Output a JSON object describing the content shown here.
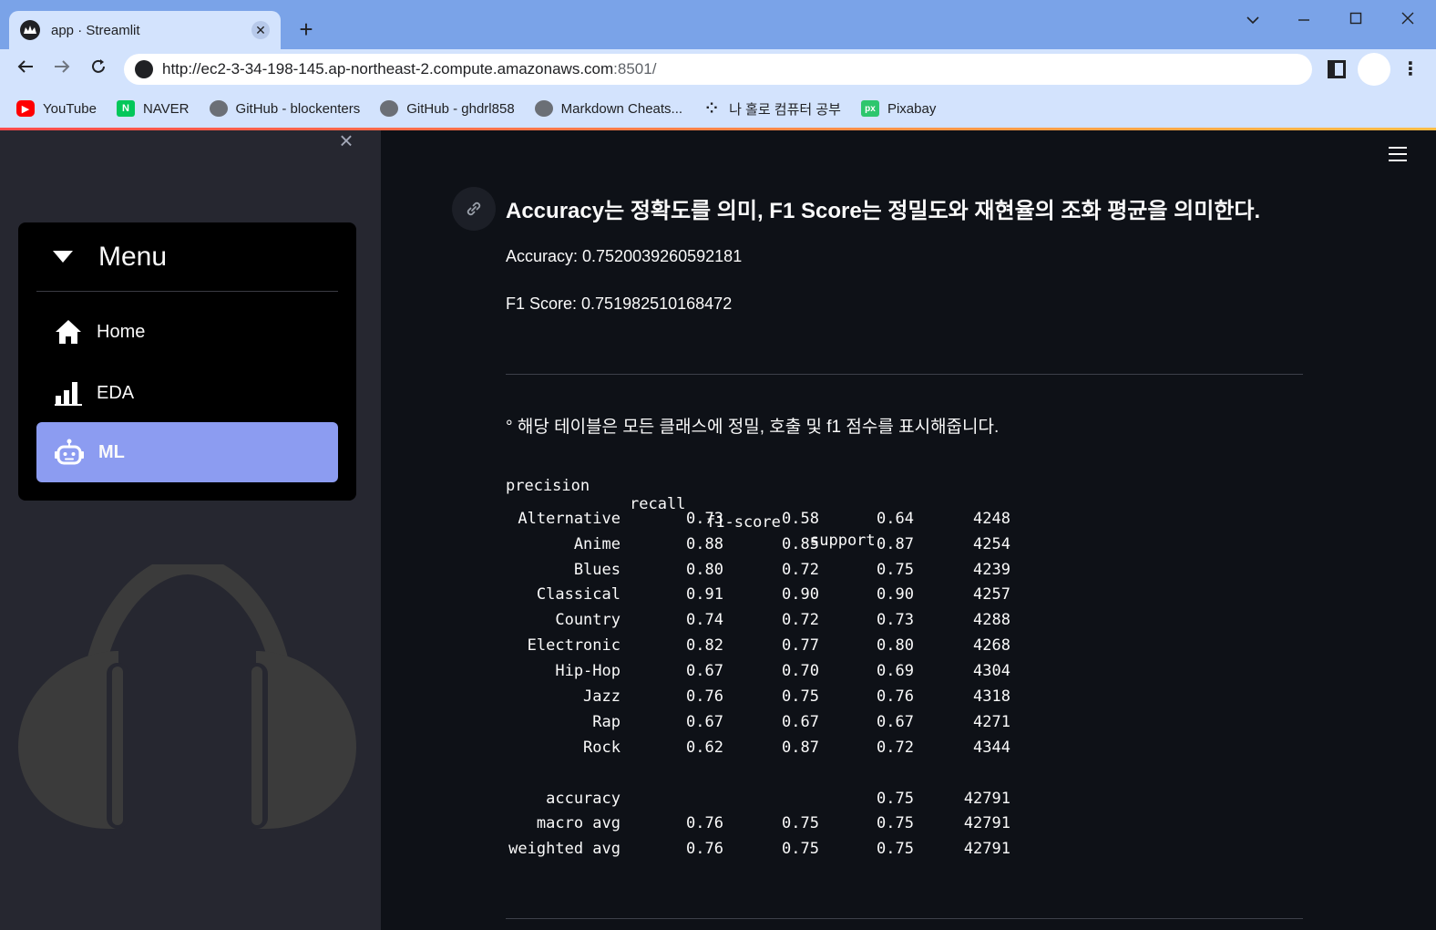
{
  "browser": {
    "tab_title": "app · Streamlit",
    "tab_close": "✕",
    "new_tab": "+",
    "url_host": "http://ec2-3-34-198-145.ap-northeast-2.compute.amazonaws.com",
    "url_port": ":8501/",
    "bookmarks": [
      {
        "label": "YouTube",
        "icon": "youtube-icon"
      },
      {
        "label": "NAVER",
        "icon": "naver-icon"
      },
      {
        "label": "GitHub - blockenters",
        "icon": "github-icon"
      },
      {
        "label": "GitHub - ghdrl858",
        "icon": "github-icon"
      },
      {
        "label": "Markdown Cheats...",
        "icon": "github-icon"
      },
      {
        "label": "나 홀로 컴퓨터 공부",
        "icon": "dots-icon"
      },
      {
        "label": "Pixabay",
        "icon": "pixabay-icon"
      }
    ]
  },
  "sidebar": {
    "close": "×",
    "menu_title": "Menu",
    "items": [
      {
        "label": "Home",
        "icon": "home-icon",
        "active": false
      },
      {
        "label": "EDA",
        "icon": "bar-chart-icon",
        "active": false
      },
      {
        "label": "ML",
        "icon": "robot-icon",
        "active": true
      }
    ]
  },
  "main": {
    "heading": "Accuracy는 정확도를 의미, F1 Score는 정밀도와 재현율의 조화 평균을 의미한다.",
    "accuracy": "Accuracy: 0.7520039260592181",
    "f1": "F1 Score: 0.751982510168472",
    "caption": "° 해당 테이블은 모든 클래스에 정밀, 호출 및 f1 점수를 표시해줍니다.",
    "report_header": [
      "precision",
      "recall",
      "f1-score",
      "support"
    ],
    "report_rows": [
      {
        "name": "Alternative",
        "precision": "0.73",
        "recall": "0.58",
        "f1": "0.64",
        "support": "4248"
      },
      {
        "name": "Anime",
        "precision": "0.88",
        "recall": "0.85",
        "f1": "0.87",
        "support": "4254"
      },
      {
        "name": "Blues",
        "precision": "0.80",
        "recall": "0.72",
        "f1": "0.75",
        "support": "4239"
      },
      {
        "name": "Classical",
        "precision": "0.91",
        "recall": "0.90",
        "f1": "0.90",
        "support": "4257"
      },
      {
        "name": "Country",
        "precision": "0.74",
        "recall": "0.72",
        "f1": "0.73",
        "support": "4288"
      },
      {
        "name": "Electronic",
        "precision": "0.82",
        "recall": "0.77",
        "f1": "0.80",
        "support": "4268"
      },
      {
        "name": "Hip-Hop",
        "precision": "0.67",
        "recall": "0.70",
        "f1": "0.69",
        "support": "4304"
      },
      {
        "name": "Jazz",
        "precision": "0.76",
        "recall": "0.75",
        "f1": "0.76",
        "support": "4318"
      },
      {
        "name": "Rap",
        "precision": "0.67",
        "recall": "0.67",
        "f1": "0.67",
        "support": "4271"
      },
      {
        "name": "Rock",
        "precision": "0.62",
        "recall": "0.87",
        "f1": "0.72",
        "support": "4344"
      }
    ],
    "report_summary": [
      {
        "name": "accuracy",
        "precision": "",
        "recall": "",
        "f1": "0.75",
        "support": "42791"
      },
      {
        "name": "macro avg",
        "precision": "0.76",
        "recall": "0.75",
        "f1": "0.75",
        "support": "42791"
      },
      {
        "name": "weighted avg",
        "precision": "0.76",
        "recall": "0.75",
        "f1": "0.75",
        "support": "42791"
      }
    ]
  },
  "colors": {
    "sidebar_bg": "#262730",
    "main_bg": "#0e1117",
    "menu_active": "#8c9cf1",
    "tabbar": "#7aa3e8",
    "toolbar": "#d3e3fd"
  }
}
